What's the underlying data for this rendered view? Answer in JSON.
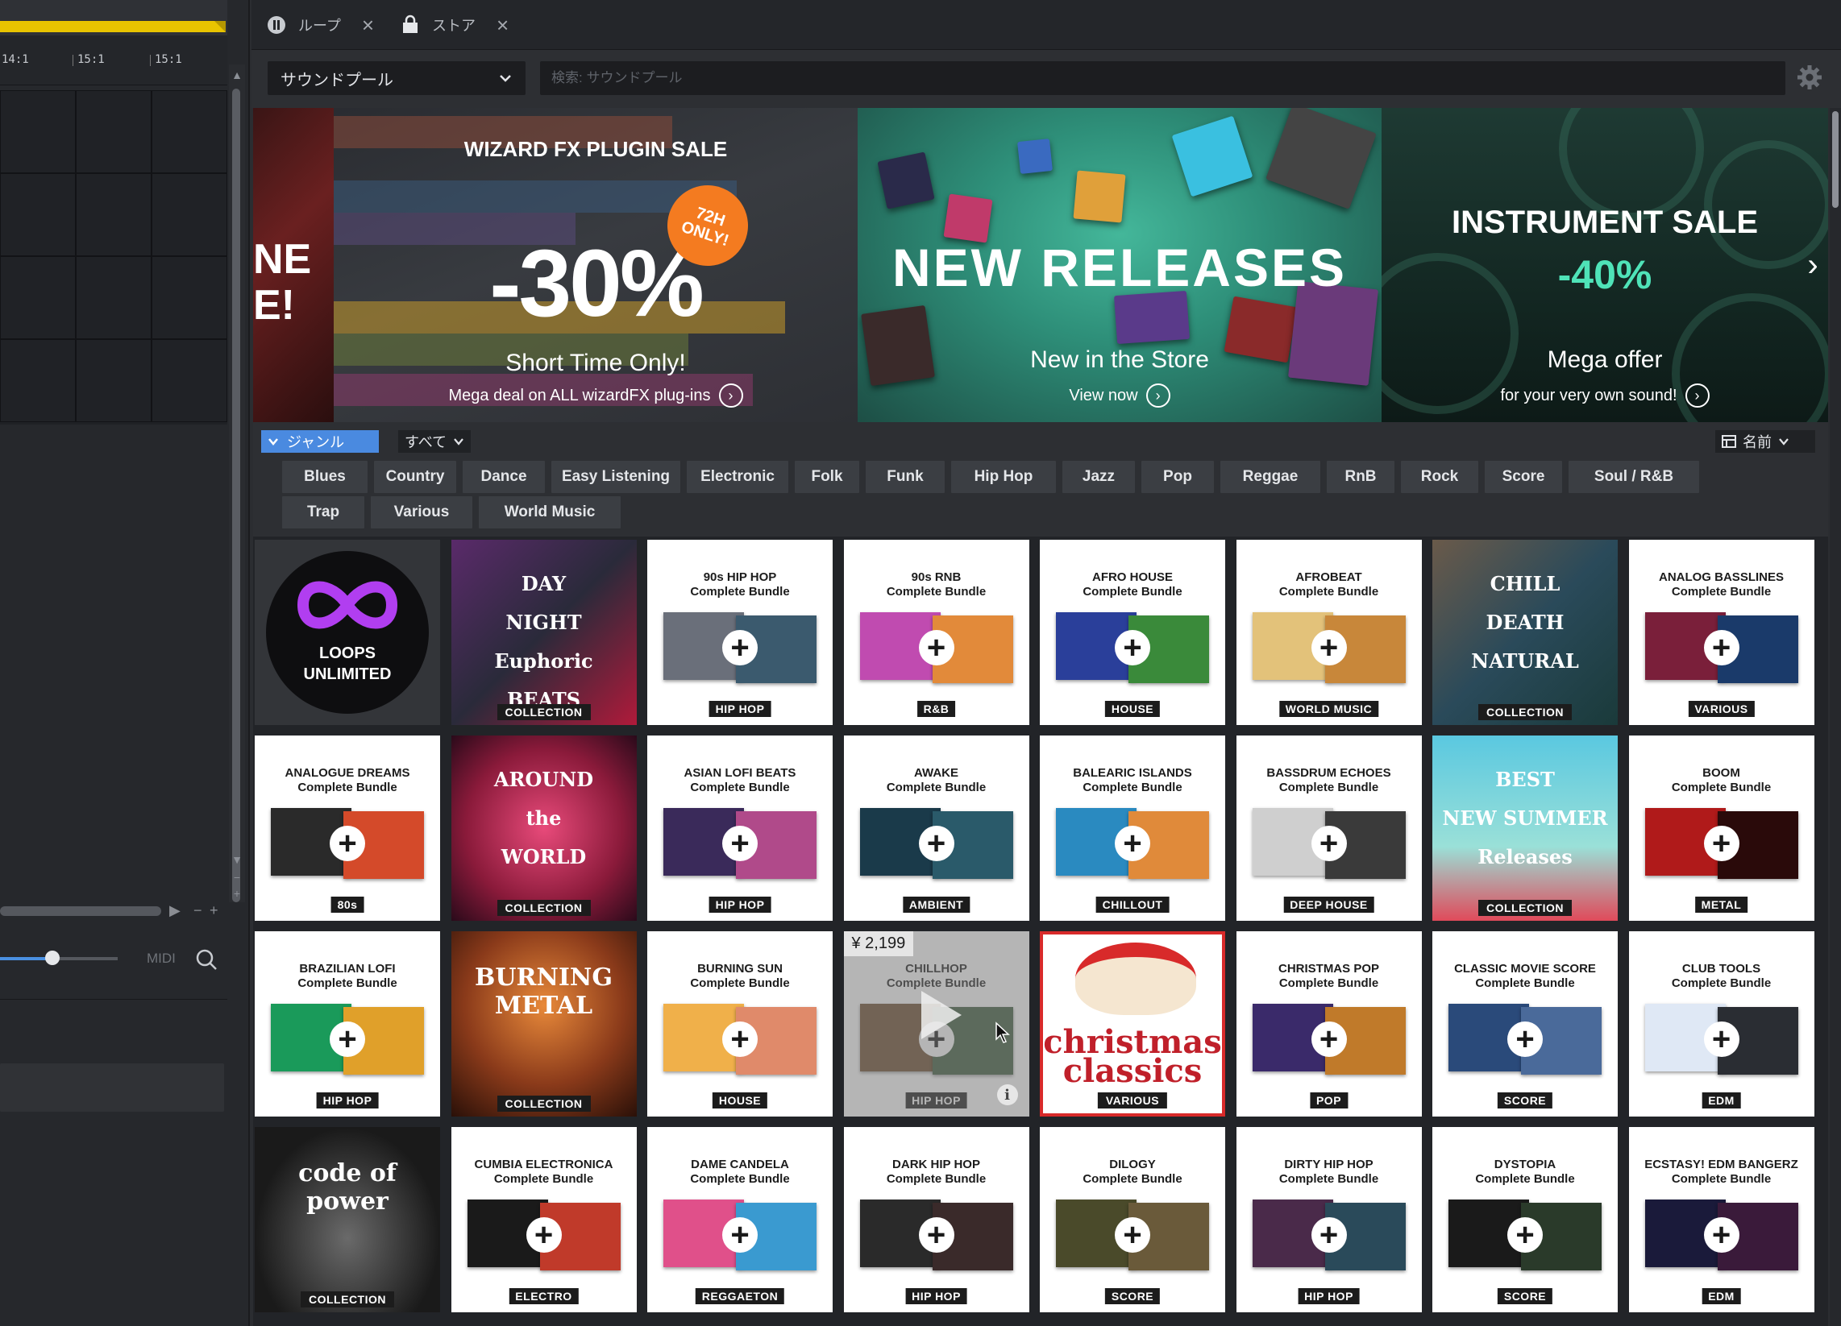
{
  "arranger": {
    "ruler_labels": [
      "14:1",
      "15:1",
      "15:1"
    ],
    "midi_label": "MIDI"
  },
  "tabs": [
    {
      "label": "ループ",
      "icon": "loop-icon"
    },
    {
      "label": "ストア",
      "icon": "store-bag-icon"
    }
  ],
  "toolbar": {
    "pool_select": "サウンドプール",
    "search_placeholder": "検索: サウンドプール"
  },
  "banners": {
    "slice_text": "NE\nE!",
    "wizard": {
      "title": "WIZARD FX PLUGIN SALE",
      "badge": "72H\nONLY!",
      "discount": "-30%",
      "subtitle": "Short Time Only!",
      "cta": "Mega deal on ALL wizardFX plug-ins"
    },
    "new_releases": {
      "title": "NEW RELEASES",
      "subtitle": "New in the Store",
      "cta": "View now"
    },
    "instrument": {
      "title": "INSTRUMENT SALE",
      "discount": "-40%",
      "subtitle": "Mega offer",
      "cta": "for your very own sound!"
    }
  },
  "filters": {
    "genre_toggle": "ジャンル",
    "all_select": "すべて",
    "sort_select": "名前"
  },
  "genres": [
    "Blues",
    "Country",
    "Dance",
    "Easy Listening",
    "Electronic",
    "Folk",
    "Funk",
    "Hip Hop",
    "Jazz",
    "Pop",
    "Reggae",
    "RnB",
    "Rock",
    "Score",
    "Soul / R&B",
    "Trap",
    "Various",
    "World Music"
  ],
  "products": [
    {
      "kind": "logo",
      "line1": "LOOPS",
      "line2": "UNLIMITED"
    },
    {
      "kind": "cover",
      "label": "COLLECTION",
      "texts": [
        "DAY",
        "NIGHT",
        "Euphoric",
        "BEATS"
      ]
    },
    {
      "kind": "bundle",
      "title": "90s HIP HOP",
      "sub": "Complete Bundle",
      "genre": "HIP HOP",
      "c1": "#6a6f7a",
      "c2": "#3b5a6e"
    },
    {
      "kind": "bundle",
      "title": "90s RNB",
      "sub": "Complete Bundle",
      "genre": "R&B",
      "c1": "#c04bb0",
      "c2": "#e28a3a"
    },
    {
      "kind": "bundle",
      "title": "AFRO HOUSE",
      "sub": "Complete Bundle",
      "genre": "HOUSE",
      "c1": "#2a3f9a",
      "c2": "#3a8a3a"
    },
    {
      "kind": "bundle",
      "title": "AFROBEAT",
      "sub": "Complete Bundle",
      "genre": "WORLD MUSIC",
      "c1": "#e3c27a",
      "c2": "#c8873a"
    },
    {
      "kind": "cover",
      "label": "COLLECTION",
      "texts": [
        "CHILL",
        "DEATH",
        "NATURAL"
      ]
    },
    {
      "kind": "bundle",
      "title": "ANALOG BASSLINES",
      "sub": "Complete Bundle",
      "genre": "VARIOUS",
      "c1": "#7a1f3a",
      "c2": "#1a3a6a"
    },
    {
      "kind": "bundle",
      "title": "ANALOGUE DREAMS",
      "sub": "Complete Bundle",
      "genre": "80s",
      "c1": "#2a2a2a",
      "c2": "#d44a2a"
    },
    {
      "kind": "cover",
      "label": "COLLECTION",
      "texts": [
        "AROUND",
        "the",
        "WORLD"
      ]
    },
    {
      "kind": "bundle",
      "title": "ASIAN LOFI BEATS",
      "sub": "Complete Bundle",
      "genre": "HIP HOP",
      "c1": "#3a2a5a",
      "c2": "#b04a8a"
    },
    {
      "kind": "bundle",
      "title": "AWAKE",
      "sub": "Complete Bundle",
      "genre": "AMBIENT",
      "c1": "#1a3a4a",
      "c2": "#2a5a6a"
    },
    {
      "kind": "bundle",
      "title": "BALEARIC ISLANDS",
      "sub": "Complete Bundle",
      "genre": "CHILLOUT",
      "c1": "#2a8ac0",
      "c2": "#e08a3a"
    },
    {
      "kind": "bundle",
      "title": "BASSDRUM ECHOES",
      "sub": "Complete Bundle",
      "genre": "DEEP HOUSE",
      "c1": "#cfcfcf",
      "c2": "#3a3a3a"
    },
    {
      "kind": "cover",
      "label": "COLLECTION",
      "texts": [
        "BEST",
        "NEW SUMMER",
        "Releases"
      ]
    },
    {
      "kind": "bundle",
      "title": "BOOM",
      "sub": "Complete Bundle",
      "genre": "METAL",
      "c1": "#b01a1a",
      "c2": "#2a0a0a"
    },
    {
      "kind": "bundle",
      "title": "BRAZILIAN LOFI",
      "sub": "Complete Bundle",
      "genre": "HIP HOP",
      "c1": "#1a9a5a",
      "c2": "#e0a02a"
    },
    {
      "kind": "cover",
      "label": "COLLECTION",
      "texts": [
        "BURNING METAL"
      ]
    },
    {
      "kind": "bundle",
      "title": "BURNING SUN",
      "sub": "Complete Bundle",
      "genre": "HOUSE",
      "c1": "#f0b04a",
      "c2": "#e08a6a"
    },
    {
      "kind": "hover",
      "title": "CHILLHOP",
      "sub": "Complete Bundle",
      "genre": "HIP HOP",
      "price": "¥ 2,199",
      "c1": "#6a4a2a",
      "c2": "#3a5a3a"
    },
    {
      "kind": "cover",
      "label": "VARIOUS",
      "texts": [
        "christmas",
        "classics"
      ]
    },
    {
      "kind": "bundle",
      "title": "CHRISTMAS POP",
      "sub": "Complete Bundle",
      "genre": "POP",
      "c1": "#3a2a6a",
      "c2": "#c07a2a"
    },
    {
      "kind": "bundle",
      "title": "CLASSIC MOVIE SCORE",
      "sub": "Complete Bundle",
      "genre": "SCORE",
      "c1": "#2a4a7a",
      "c2": "#4a6a9a"
    },
    {
      "kind": "bundle",
      "title": "CLUB TOOLS",
      "sub": "Complete Bundle",
      "genre": "EDM",
      "c1": "#dfe8f5",
      "c2": "#2a2d33"
    },
    {
      "kind": "cover",
      "label": "COLLECTION",
      "texts": [
        "code of power"
      ]
    },
    {
      "kind": "bundle",
      "title": "CUMBIA ELECTRONICA",
      "sub": "Complete Bundle",
      "genre": "ELECTRO",
      "c1": "#1a1a1a",
      "c2": "#c03a2a"
    },
    {
      "kind": "bundle",
      "title": "DAME CANDELA",
      "sub": "Complete Bundle",
      "genre": "REGGAETON",
      "c1": "#e0508a",
      "c2": "#3a9ad0"
    },
    {
      "kind": "bundle",
      "title": "DARK HIP HOP",
      "sub": "Complete Bundle",
      "genre": "HIP HOP",
      "c1": "#2a2a2a",
      "c2": "#3a2a2a"
    },
    {
      "kind": "bundle",
      "title": "DILOGY",
      "sub": "Complete Bundle",
      "genre": "SCORE",
      "c1": "#4a4a2a",
      "c2": "#6a5a3a"
    },
    {
      "kind": "bundle",
      "title": "DIRTY HIP HOP",
      "sub": "Complete Bundle",
      "genre": "HIP HOP",
      "c1": "#4a2a4a",
      "c2": "#2a4a5a"
    },
    {
      "kind": "bundle",
      "title": "DYSTOPIA",
      "sub": "Complete Bundle",
      "genre": "SCORE",
      "c1": "#1a1a1a",
      "c2": "#2a3a2a"
    },
    {
      "kind": "bundle",
      "title": "ECSTASY! EDM BANGERZ",
      "sub": "Complete Bundle",
      "genre": "EDM",
      "c1": "#1a1a3a",
      "c2": "#3a1a3a"
    }
  ],
  "colors": {
    "accent_blue": "#4a8ae0",
    "loop_yellow": "#e9c400",
    "badge_orange": "#f47b20",
    "instrument_green": "#4fe3b8"
  }
}
